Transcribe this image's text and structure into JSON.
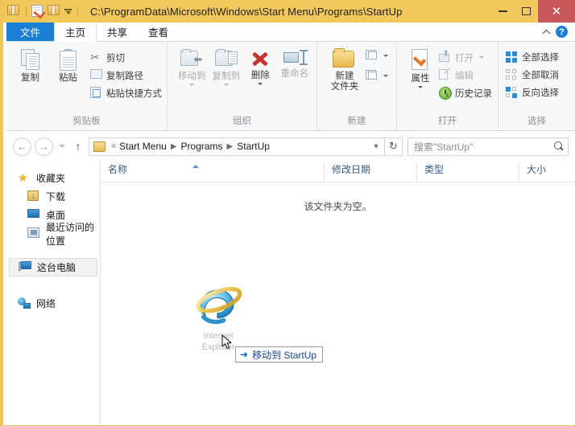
{
  "window": {
    "title": "C:\\ProgramData\\Microsoft\\Windows\\Start Menu\\Programs\\StartUp",
    "quick_access": [
      {
        "name": "folder-icon",
        "label": "属性"
      },
      {
        "name": "properties-icon",
        "label": "属性"
      },
      {
        "name": "new-folder-icon",
        "label": "新建文件夹"
      },
      {
        "name": "customize-caret-icon",
        "label": "自定义快速访问工具栏"
      }
    ],
    "controls": {
      "minimize": "–",
      "maximize": "□",
      "close": "✕"
    }
  },
  "tabs": {
    "file": "文件",
    "items": [
      {
        "label": "主页",
        "active": true
      },
      {
        "label": "共享",
        "active": false
      },
      {
        "label": "查看",
        "active": false
      }
    ],
    "collapse_label": "折叠功能区",
    "help_label": "?"
  },
  "ribbon": {
    "groups": [
      {
        "label": "剪贴板",
        "big": [
          {
            "label": "复制",
            "icon": "copy-icon"
          },
          {
            "label": "粘贴",
            "icon": "paste-icon"
          }
        ],
        "small": [
          {
            "label": "剪切",
            "icon": "scissors-icon",
            "disabled": false
          },
          {
            "label": "复制路径",
            "icon": "copy-path-icon",
            "disabled": false
          },
          {
            "label": "粘贴快捷方式",
            "icon": "paste-shortcut-icon",
            "disabled": false
          }
        ]
      },
      {
        "label": "组织",
        "big": [
          {
            "label": "移动到",
            "icon": "move-to-icon",
            "dropdown": true,
            "disabled": true
          },
          {
            "label": "复制到",
            "icon": "copy-to-icon",
            "dropdown": true,
            "disabled": true
          },
          {
            "label": "删除",
            "icon": "delete-icon",
            "dropdown": true,
            "disabled": false
          },
          {
            "label": "重命名",
            "icon": "rename-icon",
            "disabled": true
          }
        ]
      },
      {
        "label": "新建",
        "big": [
          {
            "label": "新建",
            "label2": "文件夹",
            "icon": "new-folder-icon"
          }
        ],
        "small": [
          {
            "label": "",
            "icon": "new-item-icon",
            "dropdown": true
          },
          {
            "label": "",
            "icon": "easy-access-icon",
            "dropdown": true
          }
        ]
      },
      {
        "label": "打开",
        "big": [
          {
            "label": "属性",
            "icon": "properties-icon",
            "dropdown": true
          }
        ],
        "small": [
          {
            "label": "打开",
            "icon": "open-icon",
            "dropdown": true,
            "disabled": true
          },
          {
            "label": "编辑",
            "icon": "edit-icon",
            "disabled": true
          },
          {
            "label": "历史记录",
            "icon": "history-icon",
            "disabled": false
          }
        ]
      },
      {
        "label": "选择",
        "small": [
          {
            "label": "全部选择",
            "icon": "select-all-icon"
          },
          {
            "label": "全部取消",
            "icon": "select-none-icon"
          },
          {
            "label": "反向选择",
            "icon": "invert-selection-icon"
          }
        ]
      }
    ]
  },
  "address": {
    "back_icon": "back-arrow-icon",
    "forward_icon": "forward-arrow-icon",
    "recent_icon": "recent-locations-icon",
    "up_icon": "up-arrow-icon",
    "breadcrumb_overflow": "«",
    "crumbs": [
      "Start Menu",
      "Programs",
      "StartUp"
    ],
    "dropdown_icon": "chevron-down-icon",
    "refresh_icon": "refresh-icon",
    "search_placeholder": "搜索\"StartUp\"",
    "search_value": "",
    "search_icon": "search-icon"
  },
  "navpane": {
    "sections": [
      {
        "label": "收藏夹",
        "icon": "star-icon",
        "children": [
          {
            "label": "下载",
            "icon": "downloads-icon"
          },
          {
            "label": "桌面",
            "icon": "desktop-icon"
          },
          {
            "label": "最近访问的位置",
            "icon": "recent-places-icon"
          }
        ]
      },
      {
        "label": "这台电脑",
        "icon": "this-pc-icon",
        "selected": true,
        "children": []
      },
      {
        "label": "网络",
        "icon": "network-icon",
        "children": []
      }
    ]
  },
  "filelist": {
    "columns": [
      {
        "label": "名称",
        "sorted": true
      },
      {
        "label": "修改日期"
      },
      {
        "label": "类型"
      },
      {
        "label": "大小"
      }
    ],
    "empty_message": "该文件夹为空。",
    "rows": []
  },
  "drag": {
    "item_label_line1": "Internet",
    "item_label_line2": "Explorer",
    "item_icon": "internet-explorer-icon",
    "cursor_icon": "drag-cursor-icon",
    "tooltip_arrow": "➜",
    "tooltip_text": "移动到 StartUp"
  }
}
